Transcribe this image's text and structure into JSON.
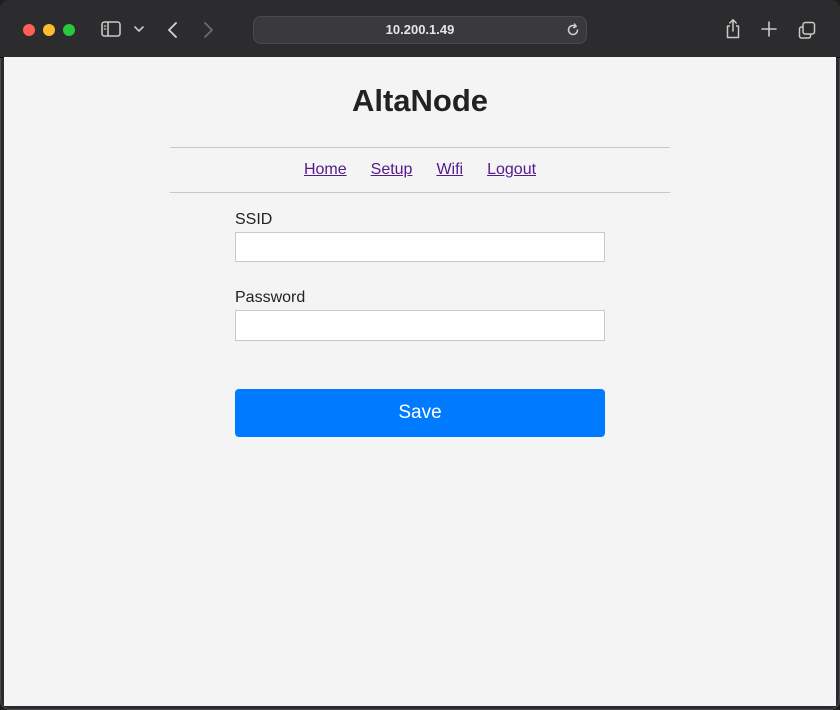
{
  "browser": {
    "url": "10.200.1.49",
    "icons": [
      "sidebar-icon",
      "chevron-down-icon",
      "back-icon",
      "forward-icon",
      "reload-icon",
      "share-icon",
      "plus-icon",
      "tabs-icon"
    ]
  },
  "page": {
    "title": "AltaNode",
    "nav": [
      "Home",
      "Setup",
      "Wifi",
      "Logout"
    ],
    "form": {
      "ssid_label": "SSID",
      "ssid_value": "",
      "password_label": "Password",
      "password_value": "",
      "save_label": "Save"
    }
  },
  "colors": {
    "accent": "#007bff",
    "link_visited": "#551a8b",
    "page_bg": "#f4f4f4"
  }
}
